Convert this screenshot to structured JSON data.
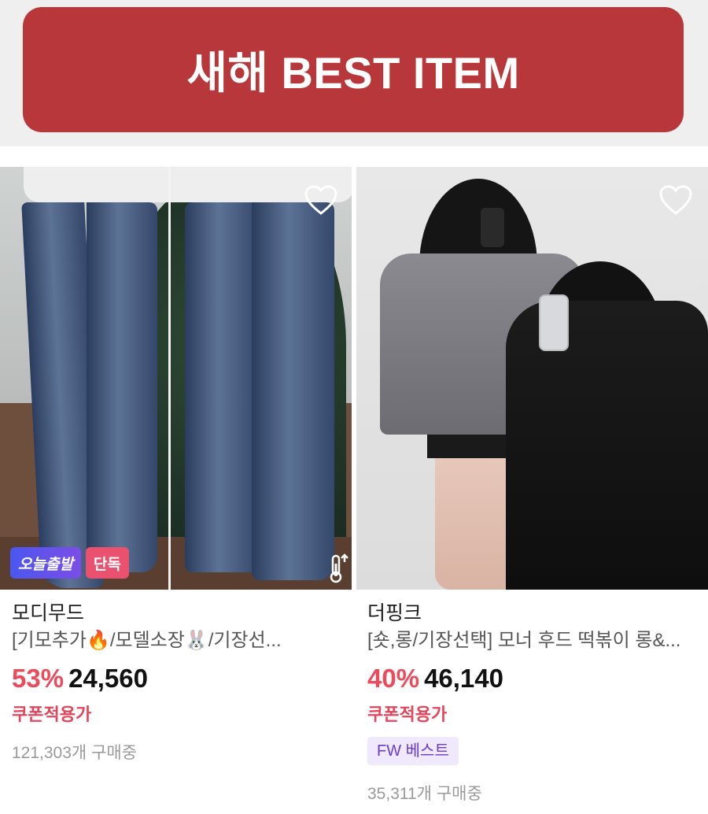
{
  "banner": {
    "title": "새해 BEST ITEM",
    "background": "#b8373b"
  },
  "products": [
    {
      "image_alt": "wide leg washed denim jeans",
      "badges": [
        "오늘출발",
        "단독"
      ],
      "brand": "모디무드",
      "name": "[기모추가🔥/모델소장🐰/기장선...",
      "discount": "53%",
      "price": "24,560",
      "coupon": "쿠폰적용가",
      "buyers": "121,303개 구매중"
    },
    {
      "image_alt": "duffle coats grey and black",
      "brand": "더핑크",
      "name": "[숏,롱/기장선택] 모너 후드 떡볶이 롱&...",
      "discount": "40%",
      "price": "46,140",
      "coupon": "쿠폰적용가",
      "tag": "FW 베스트",
      "buyers": "35,311개 구매중"
    }
  ],
  "colors": {
    "discount": "#ec4b5b",
    "coupon": "#e6445a",
    "tag_bg": "#f0e9fb",
    "tag_text": "#6a3ccd"
  },
  "icons": {
    "wishlist": "heart-outline-icon",
    "thermo": "thermometer-up-icon"
  }
}
